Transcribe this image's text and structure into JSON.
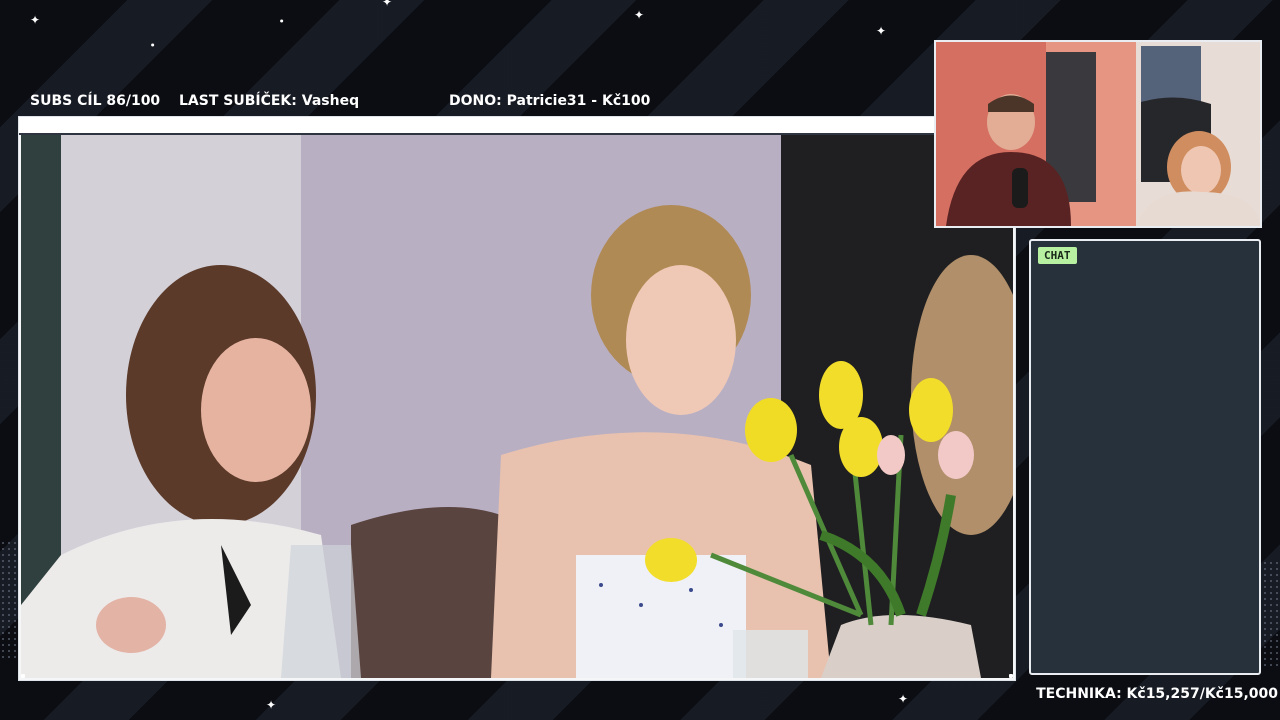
{
  "overlay": {
    "subs_goal": "SUBS CÍL 86/100",
    "last_sub": "LAST SUBÍČEK: Vasheq",
    "donation": "DONO: Patricie31 - Kč100",
    "technika": "TECHNIKA: Kč15,257/Kč15,000"
  },
  "chat": {
    "label": "CHAT"
  },
  "icons": {
    "star": "sparkle-star-icon"
  },
  "colors": {
    "background": "#0b0d12",
    "chat_panel": "#27313b",
    "chat_badge": "#b6f0a0",
    "frame_border": "#e9ecf0"
  }
}
